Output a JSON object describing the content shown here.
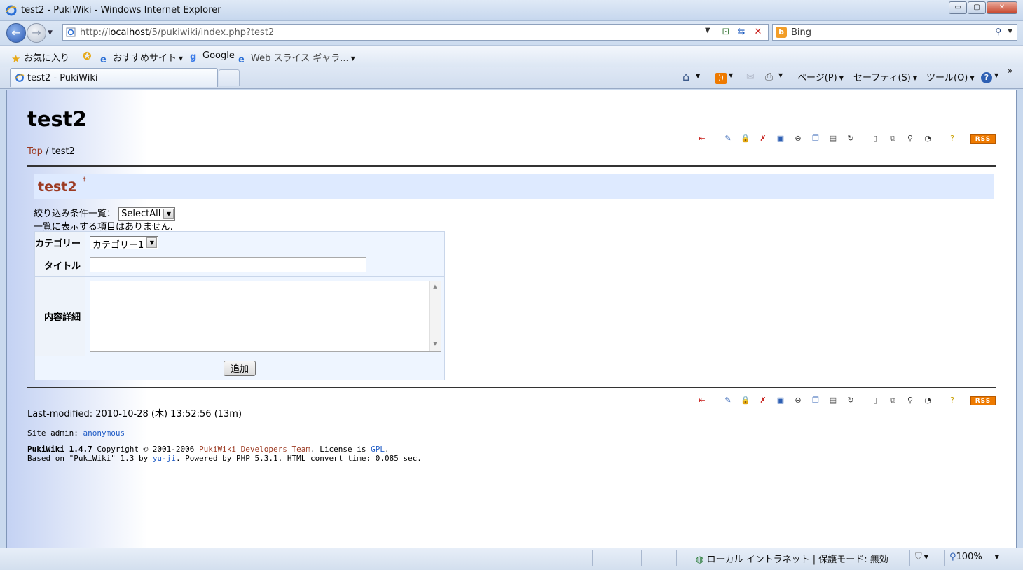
{
  "window": {
    "title": "test2 - PukiWiki - Windows Internet Explorer",
    "min_label": "▭",
    "max_label": "▢",
    "close_label": "✕"
  },
  "address": {
    "url_prefix": "http://",
    "url_host": "localhost",
    "url_path": "/5/pukiwiki/index.php?test2"
  },
  "search": {
    "value": "Bing",
    "engine_icon": "b"
  },
  "favorites": {
    "favorites_label": "お気に入り",
    "items": [
      "おすすめサイト",
      "Google",
      "Web スライス ギャラ..."
    ]
  },
  "tabs": [
    {
      "label": "test2 - PukiWiki"
    }
  ],
  "commands": {
    "page": "ページ(P)",
    "safety": "セーフティ(S)",
    "tools": "ツール(O)",
    "more": "»"
  },
  "page": {
    "site_title": "test2",
    "breadcrumb_top": "Top",
    "breadcrumb_sep": " / ",
    "breadcrumb_current": "test2",
    "heading": "test2",
    "heading_anchor": "†",
    "filter_label": "絞り込み条件一覧：",
    "filter_value": "SelectAll",
    "empty_message": "一覧に表示する項目はありません.",
    "form": {
      "category_label": "カテゴリー",
      "category_value": "カテゴリー1",
      "title_label": "タイトル",
      "title_value": "",
      "details_label": "内容詳細",
      "details_value": "",
      "submit_label": "追加"
    },
    "rss_label": "RSS",
    "last_modified_label": "Last-modified:",
    "last_modified_value": "2010-10-28 (木) 13:52:56 (13m)",
    "site_admin_label": "Site admin:",
    "site_admin_value": "anonymous",
    "credits_line1_a": "PukiWiki 1.4.7",
    "credits_line1_b": " Copyright © 2001-2006 ",
    "credits_line1_c": "PukiWiki Developers Team",
    "credits_line1_d": ". License is ",
    "credits_line1_e": "GPL",
    "credits_line1_f": ".",
    "credits_line2_a": "Based on \"PukiWiki\" 1.3 by ",
    "credits_line2_b": "yu-ji",
    "credits_line2_c": ". Powered by PHP 5.3.1. HTML convert time: 0.085 sec."
  },
  "status": {
    "zone": "ローカル イントラネット | 保護モード: 無効",
    "zoom": "100%"
  },
  "colors": {
    "link": "#9c3a22",
    "heading_bg": "#deeaff",
    "rss": "#ee7a00"
  }
}
